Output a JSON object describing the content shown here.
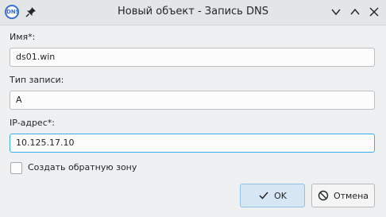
{
  "window": {
    "title": "Новый объект - Запись DNS",
    "app_icon_text": "DNS",
    "icons": [
      "app-dns-icon",
      "pin-icon",
      "minimize-icon",
      "maximize-icon",
      "close-icon"
    ]
  },
  "form": {
    "name_label": "Имя*:",
    "name_value": "ds01.win",
    "type_label": "Тип записи:",
    "type_value": "A",
    "ip_label": "IP-адрес*:",
    "ip_value": "10.125.17.10",
    "reverse_zone_label": "Создать обратную зону",
    "reverse_zone_checked": false
  },
  "buttons": {
    "ok_label": "OK",
    "cancel_label": "Отмена"
  },
  "colors": {
    "accent": "#3daee9",
    "ok_bg": "#d6e6f3"
  }
}
